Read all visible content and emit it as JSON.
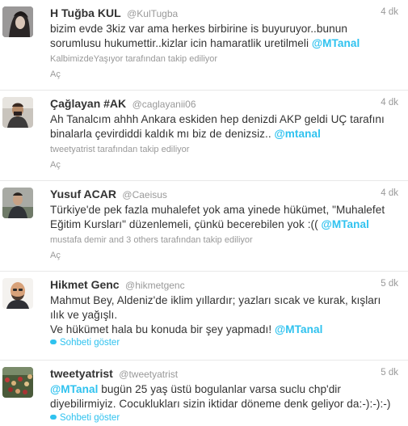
{
  "tweets": [
    {
      "name": "H Tuğba KUL",
      "handle": "@KulTugba",
      "time": "4 dk",
      "line1": "bizim evde 3kiz var ama  herkes birbirine is buyuruyor..bunun",
      "line2": "sorumlusu hukumettir..kizlar icin hamaratlik uretilmeli",
      "mention": "@MTanal",
      "followed_by": "KalbimizdeYaşıyor tarafından takip ediliyor",
      "action": "Aç",
      "avatar_icon": "profile-photo"
    },
    {
      "name": "Çağlayan #AK",
      "handle": "@caglayanii06",
      "time": "4 dk",
      "line1": "Ah Tanalcım ahhh Ankara eskiden hep denizdi AKP geldi UÇ tarafını",
      "line2": "binalarla çevirdiddi kaldık mı biz de denizsiz..",
      "mention": "@mtanal",
      "followed_by": "tweetyatrist tarafından takip ediliyor",
      "action": "Aç",
      "avatar_icon": "profile-photo"
    },
    {
      "name": "Yusuf ACAR",
      "handle": "@Caeisus",
      "time": "4 dk",
      "line1": "Türkiye'de pek fazla muhalefet yok ama yinede hükümet, \"Muhalefet",
      "line2": "Eğitim Kursları\" düzenlemeli, çünkü becerebilen yok :((",
      "mention": "@MTanal",
      "followed_by": "mustafa demir and 3 others tarafından takip ediliyor",
      "action": "Aç",
      "avatar_icon": "profile-photo"
    },
    {
      "name": "Hikmet Genc",
      "handle": "@hikmetgenc",
      "time": "5 dk",
      "line1": "Mahmut Bey, Aldeniz'de iklim yıllardır; yazları sıcak ve kurak, kışları",
      "line2": "ılık ve yağışlı.",
      "line3": "Ve hükümet hala bu konuda bir şey yapmadı!",
      "mention": "@MTanal",
      "conversation": "Sohbeti göster",
      "avatar_icon": "profile-photo"
    },
    {
      "name": "tweetyatrist",
      "handle": "@tweetyatrist",
      "time": "5 dk",
      "mention": "@MTanal",
      "line1_rest": " bugün 25 yaş üstü bogulanlar varsa suclu chp'dir",
      "line2": "diyebilirmiyiz. Cocuklukları sizin iktidar döneme denk geliyor da:-):-):-)",
      "conversation": "Sohbeti göster",
      "avatar_icon": "profile-photo"
    }
  ],
  "colors": {
    "mention": "#2fc2ef",
    "muted": "#999999",
    "text": "#333333"
  }
}
